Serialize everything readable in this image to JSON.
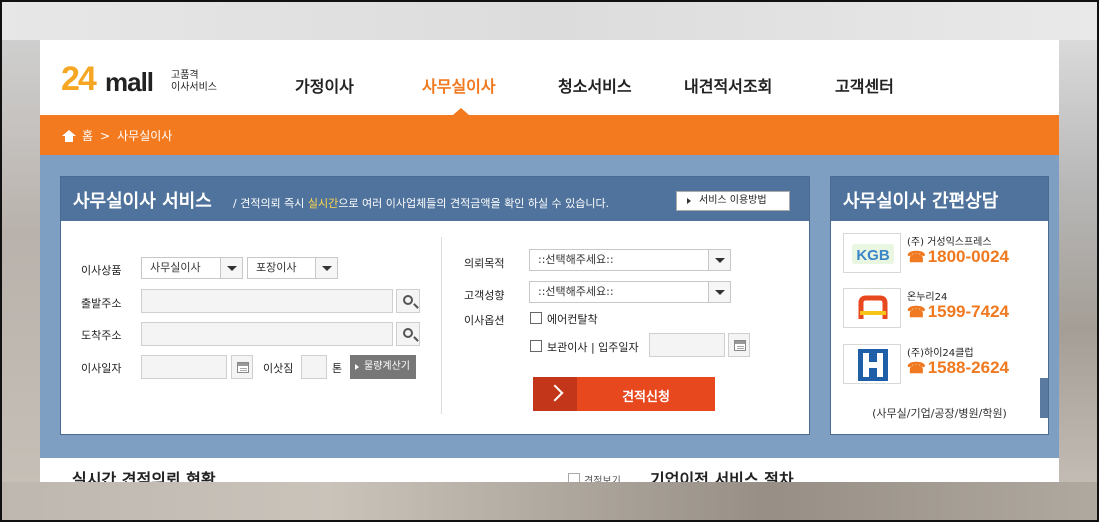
{
  "logo": {
    "num": "24",
    "mall": "mall",
    "sub1": "고품격",
    "sub2": "이사서비스"
  },
  "gnb": [
    {
      "label": "가정이사"
    },
    {
      "label": "사무실이사"
    },
    {
      "label": "청소서비스"
    },
    {
      "label": "내견적서조회"
    },
    {
      "label": "고객센터"
    }
  ],
  "breadcrumb": {
    "home": "홈",
    "separator": ">",
    "current": "사무실이사"
  },
  "main": {
    "title": "사무실이사 서비스",
    "desc_pre": "/ 견적의뢰 즉시 ",
    "desc_hl": "실시간",
    "desc_post": "으로 여러 이사업체들의 견적금액을 확인 하실 수 있습니다.",
    "guide_btn": "서비스 이용방법",
    "form": {
      "product_label": "이사상품",
      "product_sel1": "사무실이사",
      "product_sel2": "포장이사",
      "from_label": "출발주소",
      "to_label": "도착주소",
      "date_label": "이사일자",
      "load_label": "이삿짐",
      "ton_unit": "톤",
      "calc_btn": "물량계산기",
      "purpose_label": "의뢰목적",
      "purpose_sel": "::선택해주세요::",
      "tendency_label": "고객성향",
      "tendency_sel": "::선택해주세요::",
      "option_label": "이사옵션",
      "opt_aircon": "에어컨탈착",
      "opt_storage": "보관이사 | 입주일자",
      "submit": "견적신청"
    }
  },
  "side": {
    "title": "사무실이사 간편상담",
    "companies": [
      {
        "logo": "KGB",
        "name": "(주) 거성익스프레스",
        "tel": "1800-0024"
      },
      {
        "logo": "nu",
        "name": "온누리24",
        "tel": "1599-7424"
      },
      {
        "logo": "H",
        "name": "(주)하이24클럽",
        "tel": "1588-2624"
      }
    ],
    "footer": "(사무실/기업/공장/병원/학원)"
  },
  "below": {
    "left_title": "실시간 견적의뢰 현황",
    "mid_text": "견적보기",
    "right_title": "기업이전 서비스 절차"
  },
  "colors": {
    "accent": "#f47a20",
    "panel_blue": "#4f739c",
    "bg_blue": "#7f9fc2",
    "submit_red": "#e8481e"
  }
}
